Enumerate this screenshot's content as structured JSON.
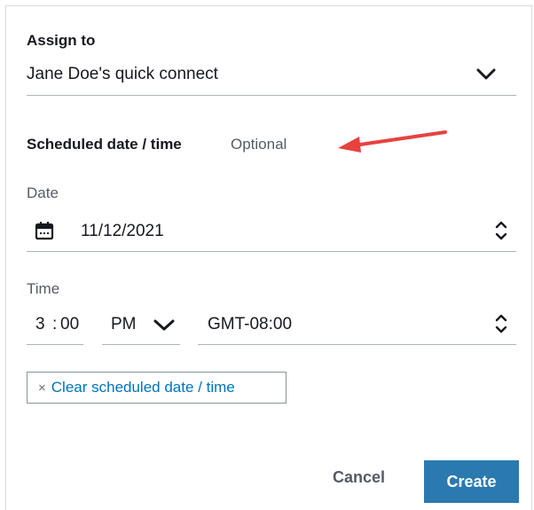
{
  "assign": {
    "label": "Assign to",
    "value": "Jane Doe's quick connect"
  },
  "schedule": {
    "title": "Scheduled date / time",
    "optional": "Optional"
  },
  "date": {
    "label": "Date",
    "value": "11/12/2021"
  },
  "time": {
    "label": "Time",
    "hour": "3",
    "separator": ":",
    "minute": "00",
    "ampm": "PM",
    "timezone": "GMT-08:00"
  },
  "clear_button": {
    "x": "×",
    "label": "Clear scheduled date / time"
  },
  "footer": {
    "cancel": "Cancel",
    "create": "Create"
  },
  "colors": {
    "primary": "#2a7ab0",
    "link": "#0073bb",
    "annotation_arrow": "#e8423f"
  },
  "icons": {
    "assign_dropdown": "chevron-down-icon",
    "date": "calendar-icon",
    "date_stepper": "up-down-chevron-icon",
    "ampm_dropdown": "chevron-down-icon",
    "timezone_stepper": "up-down-chevron-icon",
    "annotation": "red-arrow-icon"
  }
}
